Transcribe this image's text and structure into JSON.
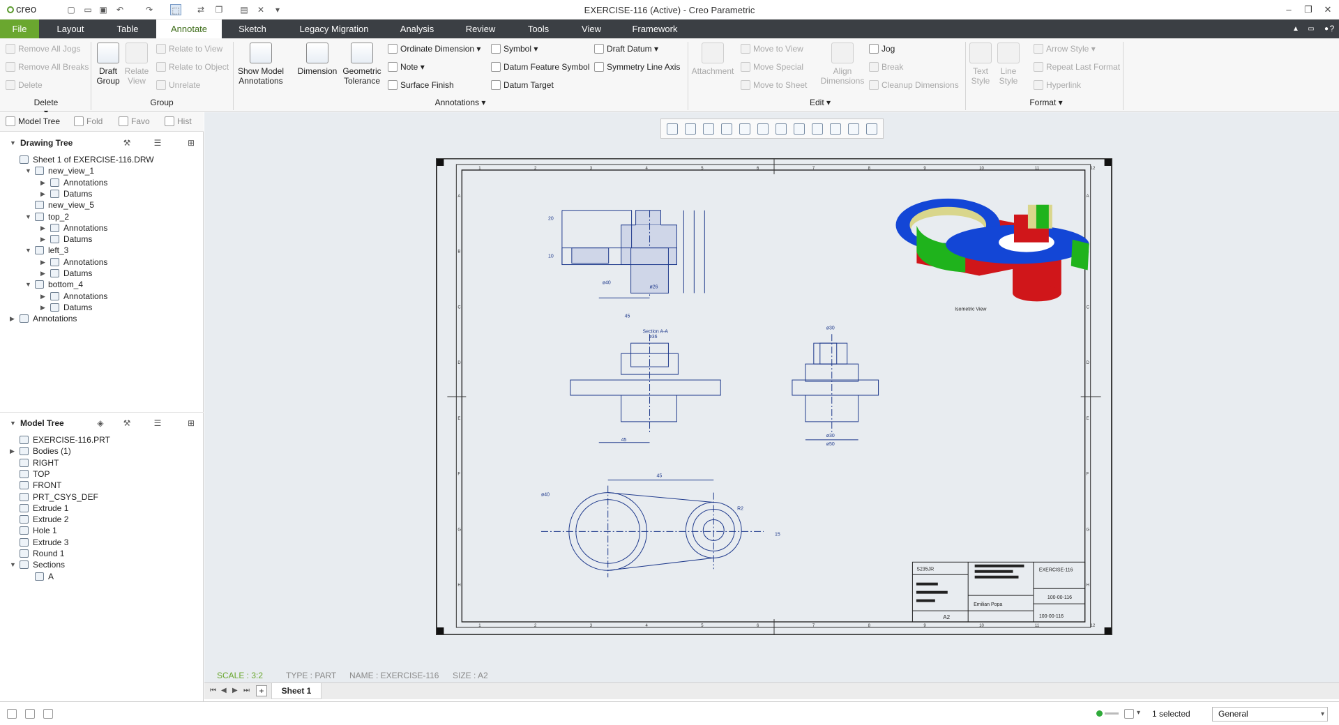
{
  "app": {
    "logo": "creo",
    "window_title": "EXERCISE-116 (Active) - Creo Parametric"
  },
  "menu": {
    "tabs": [
      "File",
      "Layout",
      "Table",
      "Annotate",
      "Sketch",
      "Legacy Migration",
      "Analysis",
      "Review",
      "Tools",
      "View",
      "Framework"
    ],
    "active": "Annotate"
  },
  "ribbon": {
    "delete": {
      "items": [
        "Remove All Jogs",
        "Remove All Breaks",
        "Delete"
      ],
      "group": "Delete"
    },
    "group": {
      "draft_group": "Draft Group",
      "relate_view": "Relate View",
      "items": [
        "Relate to View",
        "Relate to Object",
        "Unrelate"
      ],
      "group": "Group"
    },
    "annotations": {
      "show_model": "Show Model Annotations",
      "dimension": "Dimension",
      "geometric_tolerance": "Geometric Tolerance",
      "ordinate": "Ordinate Dimension",
      "note": "Note",
      "surface_finish": "Surface Finish",
      "symbol": "Symbol",
      "datum_feature_symbol": "Datum Feature Symbol",
      "datum_target": "Datum Target",
      "draft_datum": "Draft Datum",
      "symmetry_line": "Symmetry Line Axis",
      "group": "Annotations"
    },
    "edit": {
      "attachment": "Attachment",
      "move_to_view": "Move to View",
      "move_special": "Move Special",
      "move_to_sheet": "Move to Sheet",
      "align": "Align Dimensions",
      "jog": "Jog",
      "break": "Break",
      "cleanup": "Cleanup Dimensions",
      "group": "Edit"
    },
    "format": {
      "text_style": "Text Style",
      "line_style": "Line Style",
      "arrow_style": "Arrow Style",
      "repeat_last": "Repeat Last Format",
      "hyperlink": "Hyperlink",
      "group": "Format"
    }
  },
  "left_panel": {
    "tabs": [
      "Model Tree",
      "Fold",
      "Favo",
      "Hist"
    ],
    "drawing_tree_title": "Drawing Tree",
    "drawing_tree": [
      "Sheet 1 of EXERCISE-116.DRW",
      "new_view_1",
      "Annotations",
      "Datums",
      "new_view_5",
      "top_2",
      "Annotations",
      "Datums",
      "left_3",
      "Annotations",
      "Datums",
      "bottom_4",
      "Annotations",
      "Datums",
      "Annotations"
    ],
    "model_tree_title": "Model Tree",
    "model_tree": [
      "EXERCISE-116.PRT",
      "Bodies (1)",
      "RIGHT",
      "TOP",
      "FRONT",
      "PRT_CSYS_DEF",
      "Extrude 1",
      "Extrude 2",
      "Hole 1",
      "Extrude 3",
      "Round 1",
      "Sections",
      "A"
    ]
  },
  "drawing": {
    "section_label": "Section A-A",
    "iso_label": "Isometric View",
    "dims": {
      "d20": "20",
      "d10": "10",
      "d15": "15",
      "d40": "ø40",
      "d26": "ø26",
      "d45": "45",
      "d36": "ø36",
      "d30": "ø30",
      "d50": "ø50",
      "r2": "R2",
      "d60": "ø40"
    },
    "title_block": {
      "material": "S235JR",
      "number": "EXERCISE-116",
      "code": "100-00-116",
      "size": "A2",
      "company": "Emilian Popa"
    },
    "border_cols": [
      "1",
      "2",
      "3",
      "4",
      "5",
      "6",
      "7",
      "8",
      "9",
      "10",
      "11",
      "12"
    ],
    "border_rows": [
      "A",
      "B",
      "C",
      "D",
      "E",
      "F",
      "G",
      "H"
    ],
    "colors": {
      "line": "#1f3a8c",
      "hatch": "#1f3a8c",
      "iso_blue": "#1346d6",
      "iso_red": "#d0161a",
      "iso_green": "#1fb31c",
      "iso_yellow": "#d9d68c"
    }
  },
  "status": {
    "scale": "SCALE : 3:2",
    "type": "TYPE : PART",
    "name": "NAME : EXERCISE-116",
    "size": "SIZE : A2"
  },
  "sheets": {
    "current": "Sheet 1"
  },
  "bottom": {
    "selected": "1 selected",
    "filter": "General"
  }
}
